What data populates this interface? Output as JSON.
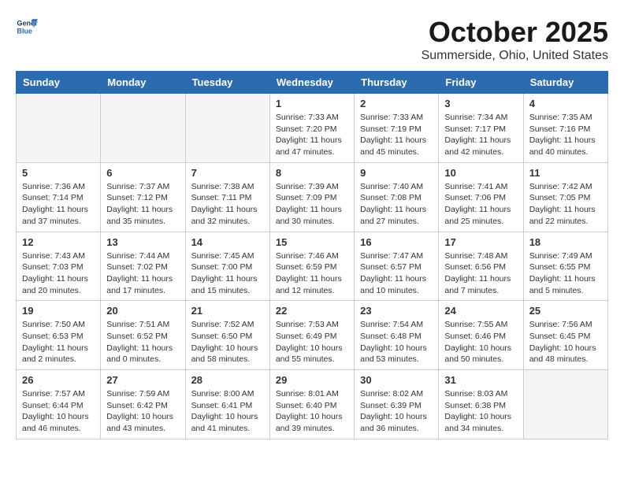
{
  "header": {
    "logo_line1": "General",
    "logo_line2": "Blue",
    "month": "October 2025",
    "location": "Summerside, Ohio, United States"
  },
  "weekdays": [
    "Sunday",
    "Monday",
    "Tuesday",
    "Wednesday",
    "Thursday",
    "Friday",
    "Saturday"
  ],
  "weeks": [
    [
      {
        "day": "",
        "info": ""
      },
      {
        "day": "",
        "info": ""
      },
      {
        "day": "",
        "info": ""
      },
      {
        "day": "1",
        "info": "Sunrise: 7:33 AM\nSunset: 7:20 PM\nDaylight: 11 hours\nand 47 minutes."
      },
      {
        "day": "2",
        "info": "Sunrise: 7:33 AM\nSunset: 7:19 PM\nDaylight: 11 hours\nand 45 minutes."
      },
      {
        "day": "3",
        "info": "Sunrise: 7:34 AM\nSunset: 7:17 PM\nDaylight: 11 hours\nand 42 minutes."
      },
      {
        "day": "4",
        "info": "Sunrise: 7:35 AM\nSunset: 7:16 PM\nDaylight: 11 hours\nand 40 minutes."
      }
    ],
    [
      {
        "day": "5",
        "info": "Sunrise: 7:36 AM\nSunset: 7:14 PM\nDaylight: 11 hours\nand 37 minutes."
      },
      {
        "day": "6",
        "info": "Sunrise: 7:37 AM\nSunset: 7:12 PM\nDaylight: 11 hours\nand 35 minutes."
      },
      {
        "day": "7",
        "info": "Sunrise: 7:38 AM\nSunset: 7:11 PM\nDaylight: 11 hours\nand 32 minutes."
      },
      {
        "day": "8",
        "info": "Sunrise: 7:39 AM\nSunset: 7:09 PM\nDaylight: 11 hours\nand 30 minutes."
      },
      {
        "day": "9",
        "info": "Sunrise: 7:40 AM\nSunset: 7:08 PM\nDaylight: 11 hours\nand 27 minutes."
      },
      {
        "day": "10",
        "info": "Sunrise: 7:41 AM\nSunset: 7:06 PM\nDaylight: 11 hours\nand 25 minutes."
      },
      {
        "day": "11",
        "info": "Sunrise: 7:42 AM\nSunset: 7:05 PM\nDaylight: 11 hours\nand 22 minutes."
      }
    ],
    [
      {
        "day": "12",
        "info": "Sunrise: 7:43 AM\nSunset: 7:03 PM\nDaylight: 11 hours\nand 20 minutes."
      },
      {
        "day": "13",
        "info": "Sunrise: 7:44 AM\nSunset: 7:02 PM\nDaylight: 11 hours\nand 17 minutes."
      },
      {
        "day": "14",
        "info": "Sunrise: 7:45 AM\nSunset: 7:00 PM\nDaylight: 11 hours\nand 15 minutes."
      },
      {
        "day": "15",
        "info": "Sunrise: 7:46 AM\nSunset: 6:59 PM\nDaylight: 11 hours\nand 12 minutes."
      },
      {
        "day": "16",
        "info": "Sunrise: 7:47 AM\nSunset: 6:57 PM\nDaylight: 11 hours\nand 10 minutes."
      },
      {
        "day": "17",
        "info": "Sunrise: 7:48 AM\nSunset: 6:56 PM\nDaylight: 11 hours\nand 7 minutes."
      },
      {
        "day": "18",
        "info": "Sunrise: 7:49 AM\nSunset: 6:55 PM\nDaylight: 11 hours\nand 5 minutes."
      }
    ],
    [
      {
        "day": "19",
        "info": "Sunrise: 7:50 AM\nSunset: 6:53 PM\nDaylight: 11 hours\nand 2 minutes."
      },
      {
        "day": "20",
        "info": "Sunrise: 7:51 AM\nSunset: 6:52 PM\nDaylight: 11 hours\nand 0 minutes."
      },
      {
        "day": "21",
        "info": "Sunrise: 7:52 AM\nSunset: 6:50 PM\nDaylight: 10 hours\nand 58 minutes."
      },
      {
        "day": "22",
        "info": "Sunrise: 7:53 AM\nSunset: 6:49 PM\nDaylight: 10 hours\nand 55 minutes."
      },
      {
        "day": "23",
        "info": "Sunrise: 7:54 AM\nSunset: 6:48 PM\nDaylight: 10 hours\nand 53 minutes."
      },
      {
        "day": "24",
        "info": "Sunrise: 7:55 AM\nSunset: 6:46 PM\nDaylight: 10 hours\nand 50 minutes."
      },
      {
        "day": "25",
        "info": "Sunrise: 7:56 AM\nSunset: 6:45 PM\nDaylight: 10 hours\nand 48 minutes."
      }
    ],
    [
      {
        "day": "26",
        "info": "Sunrise: 7:57 AM\nSunset: 6:44 PM\nDaylight: 10 hours\nand 46 minutes."
      },
      {
        "day": "27",
        "info": "Sunrise: 7:59 AM\nSunset: 6:42 PM\nDaylight: 10 hours\nand 43 minutes."
      },
      {
        "day": "28",
        "info": "Sunrise: 8:00 AM\nSunset: 6:41 PM\nDaylight: 10 hours\nand 41 minutes."
      },
      {
        "day": "29",
        "info": "Sunrise: 8:01 AM\nSunset: 6:40 PM\nDaylight: 10 hours\nand 39 minutes."
      },
      {
        "day": "30",
        "info": "Sunrise: 8:02 AM\nSunset: 6:39 PM\nDaylight: 10 hours\nand 36 minutes."
      },
      {
        "day": "31",
        "info": "Sunrise: 8:03 AM\nSunset: 6:38 PM\nDaylight: 10 hours\nand 34 minutes."
      },
      {
        "day": "",
        "info": ""
      }
    ]
  ]
}
